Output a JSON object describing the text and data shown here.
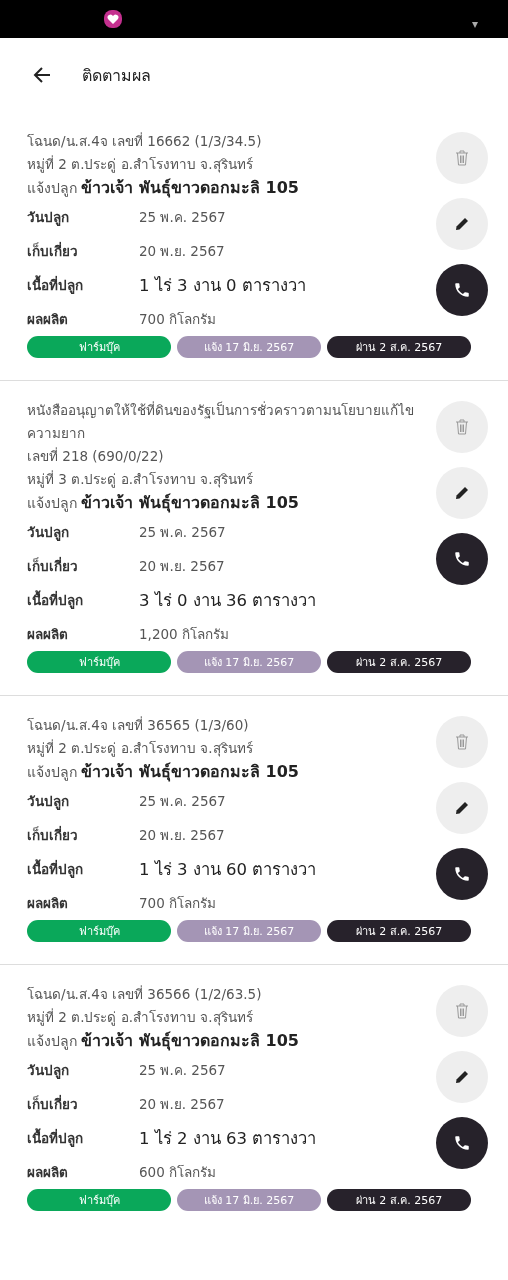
{
  "header": {
    "title": "ติดตามผล"
  },
  "cards": [
    {
      "title_lines": [
        "โฉนด/น.ส.4จ เลขที่ 16662 (1/3/34.5)"
      ],
      "address": "หมู่ที่ 2 ต.ประดู่ อ.สำโรงทาบ จ.สุรินทร์",
      "crop": "แจ้งปลูก **ข้าวเจ้า พันธุ์ขาวดอกมะลิ 105**",
      "rows": [
        {
          "kind": "normal",
          "label": "วันปลูก",
          "value": "25 พ.ค. 2567"
        },
        {
          "kind": "normal",
          "label": "เก็บเกี่ยว",
          "value": "20 พ.ย. 2567"
        },
        {
          "kind": "emphasis",
          "label": "เนื้อที่ปลูก",
          "value": "1 ไร่ 3 งาน 0 ตารางวา"
        },
        {
          "kind": "normal",
          "label": "ผลผลิต",
          "value": "700 กิโลกรัม"
        }
      ],
      "pills": [
        {
          "label": "ฟาร์มบุ๊ค",
          "color": "#0aa85a"
        },
        {
          "label": "แจ้ง 17 มิ.ย. 2567",
          "color": "#a495b5"
        },
        {
          "label": "ผ่าน 2 ส.ค. 2567",
          "color": "#27222b"
        }
      ]
    },
    {
      "title_lines": [
        "หนังสืออนุญาตให้ใช้ที่ดินของรัฐเป็นการชั่วคราวตามนโยบายแก้ไขความยาก",
        "เลขที่ 218 (690/0/22)"
      ],
      "address": "หมู่ที่ 3 ต.ประดู่ อ.สำโรงทาบ จ.สุรินทร์",
      "crop": "แจ้งปลูก **ข้าวเจ้า พันธุ์ขาวดอกมะลิ 105**",
      "rows": [
        {
          "kind": "normal",
          "label": "วันปลูก",
          "value": "25 พ.ค. 2567"
        },
        {
          "kind": "normal",
          "label": "เก็บเกี่ยว",
          "value": "20 พ.ย. 2567"
        },
        {
          "kind": "emphasis",
          "label": "เนื้อที่ปลูก",
          "value": "3 ไร่ 0 งาน 36 ตารางวา"
        },
        {
          "kind": "normal",
          "label": "ผลผลิต",
          "value": "1,200 กิโลกรัม"
        }
      ],
      "pills": [
        {
          "label": "ฟาร์มบุ๊ค",
          "color": "#0aa85a"
        },
        {
          "label": "แจ้ง 17 มิ.ย. 2567",
          "color": "#a495b5"
        },
        {
          "label": "ผ่าน 2 ส.ค. 2567",
          "color": "#27222b"
        }
      ]
    },
    {
      "title_lines": [
        "โฉนด/น.ส.4จ เลขที่ 36565 (1/3/60)"
      ],
      "address": "หมู่ที่ 2 ต.ประดู่ อ.สำโรงทาบ จ.สุรินทร์",
      "crop": "แจ้งปลูก **ข้าวเจ้า พันธุ์ขาวดอกมะลิ 105**",
      "rows": [
        {
          "kind": "normal",
          "label": "วันปลูก",
          "value": "25 พ.ค. 2567"
        },
        {
          "kind": "normal",
          "label": "เก็บเกี่ยว",
          "value": "20 พ.ย. 2567"
        },
        {
          "kind": "emphasis",
          "label": "เนื้อที่ปลูก",
          "value": "1 ไร่ 3 งาน 60 ตารางวา"
        },
        {
          "kind": "normal",
          "label": "ผลผลิต",
          "value": "700 กิโลกรัม"
        }
      ],
      "pills": [
        {
          "label": "ฟาร์มบุ๊ค",
          "color": "#0aa85a"
        },
        {
          "label": "แจ้ง 17 มิ.ย. 2567",
          "color": "#a495b5"
        },
        {
          "label": "ผ่าน 2 ส.ค. 2567",
          "color": "#27222b"
        }
      ]
    },
    {
      "title_lines": [
        "โฉนด/น.ส.4จ เลขที่ 36566 (1/2/63.5)"
      ],
      "address": "หมู่ที่ 2 ต.ประดู่ อ.สำโรงทาบ จ.สุรินทร์",
      "crop": "แจ้งปลูก **ข้าวเจ้า พันธุ์ขาวดอกมะลิ 105**",
      "rows": [
        {
          "kind": "normal",
          "label": "วันปลูก",
          "value": "25 พ.ค. 2567"
        },
        {
          "kind": "normal",
          "label": "เก็บเกี่ยว",
          "value": "20 พ.ย. 2567"
        },
        {
          "kind": "emphasis",
          "label": "เนื้อที่ปลูก",
          "value": "1 ไร่ 2 งาน 63 ตารางวา"
        },
        {
          "kind": "normal",
          "label": "ผลผลิต",
          "value": "600 กิโลกรัม"
        }
      ],
      "pills": [
        {
          "label": "ฟาร์มบุ๊ค",
          "color": "#0aa85a"
        },
        {
          "label": "แจ้ง 17 มิ.ย. 2567",
          "color": "#a495b5"
        },
        {
          "label": "ผ่าน 2 ส.ค. 2567",
          "color": "#27222b"
        }
      ]
    }
  ]
}
